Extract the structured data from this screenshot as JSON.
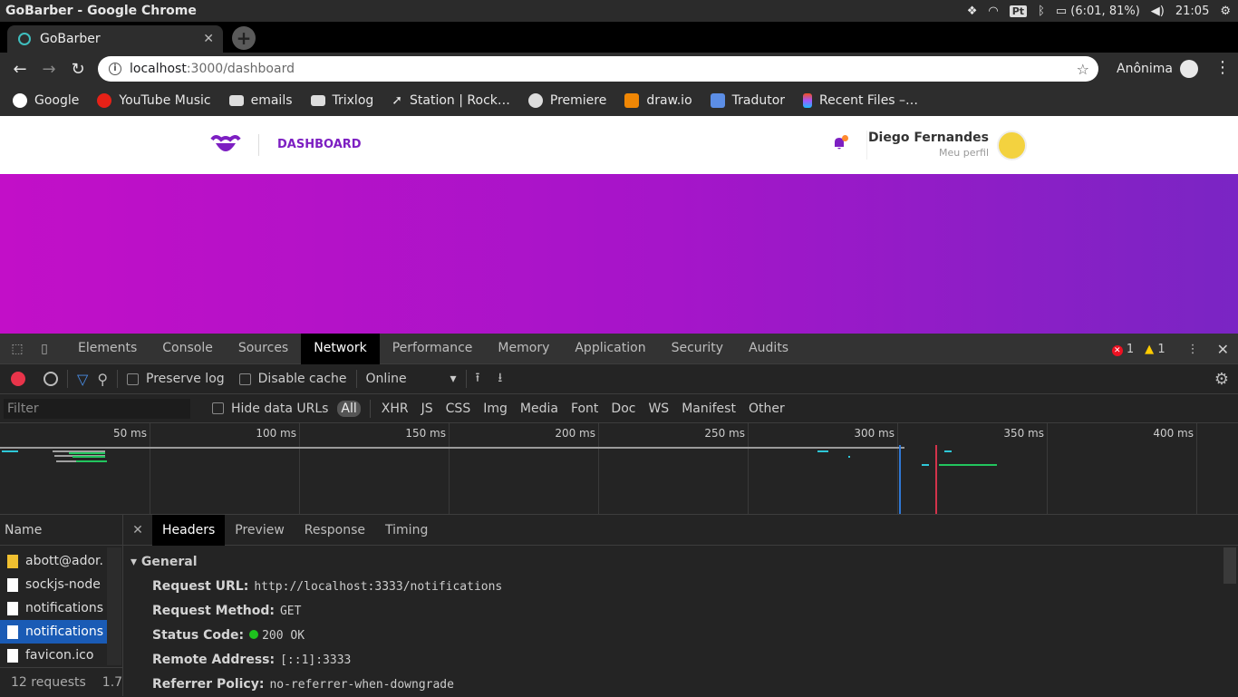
{
  "os": {
    "window_title": "GoBarber - Google Chrome",
    "battery": "(6:01, 81%)",
    "clock": "21:05",
    "keyboard": "Pt"
  },
  "browser": {
    "tab_title": "GoBarber",
    "url_host": "localhost",
    "url_path": ":3000/dashboard",
    "profile_label": "Anônima",
    "bookmarks": [
      "Google",
      "YouTube Music",
      "emails",
      "Trixlog",
      "Station | Rock…",
      "Premiere",
      "draw.io",
      "Tradutor",
      "Recent Files –…"
    ]
  },
  "app": {
    "nav_link": "DASHBOARD",
    "user_name": "Diego Fernandes",
    "profile_link": "Meu perfil",
    "brand_color": "#7d1fc2"
  },
  "devtools": {
    "tabs": [
      "Elements",
      "Console",
      "Sources",
      "Network",
      "Performance",
      "Memory",
      "Application",
      "Security",
      "Audits"
    ],
    "active_tab": "Network",
    "error_count": "1",
    "warning_count": "1",
    "toolbar": {
      "preserve_log": "Preserve log",
      "disable_cache": "Disable cache",
      "throttle": "Online"
    },
    "filter": {
      "placeholder": "Filter",
      "hide_data_urls": "Hide data URLs",
      "types": [
        "All",
        "XHR",
        "JS",
        "CSS",
        "Img",
        "Media",
        "Font",
        "Doc",
        "WS",
        "Manifest",
        "Other"
      ]
    },
    "timeline_ticks": [
      "50 ms",
      "100 ms",
      "150 ms",
      "200 ms",
      "250 ms",
      "300 ms",
      "350 ms",
      "400 ms"
    ],
    "requests_header": "Name",
    "requests": [
      {
        "name": "abott@ador.",
        "type": "img"
      },
      {
        "name": "sockjs-node",
        "type": "doc"
      },
      {
        "name": "notifications",
        "type": "doc"
      },
      {
        "name": "notifications",
        "type": "doc",
        "selected": true
      },
      {
        "name": "favicon.ico",
        "type": "doc"
      }
    ],
    "summary": "12 requests",
    "summary_tail": "1.7",
    "detail_tabs": [
      "Headers",
      "Preview",
      "Response",
      "Timing"
    ],
    "general_title": "General",
    "headers": [
      {
        "key": "Request URL:",
        "value": "http://localhost:3333/notifications"
      },
      {
        "key": "Request Method:",
        "value": "GET"
      },
      {
        "key": "Status Code:",
        "value": "200 OK"
      },
      {
        "key": "Remote Address:",
        "value": "[::1]:3333"
      },
      {
        "key": "Referrer Policy:",
        "value": "no-referrer-when-downgrade"
      }
    ]
  }
}
